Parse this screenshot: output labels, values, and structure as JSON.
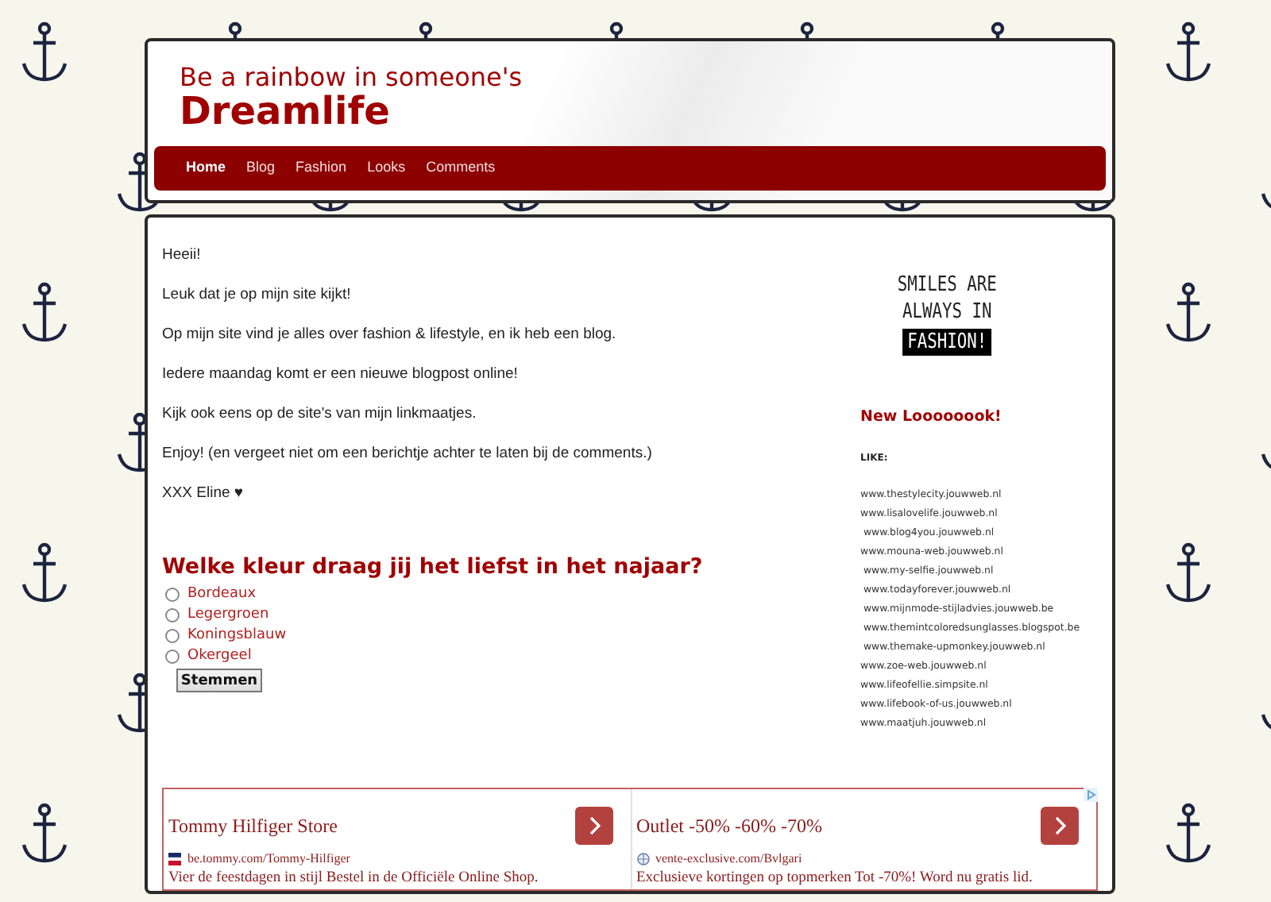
{
  "header": {
    "tagline": "Be a rainbow in someone's",
    "title": "Dreamlife"
  },
  "nav": [
    {
      "label": "Home",
      "selected": true
    },
    {
      "label": "Blog",
      "selected": false
    },
    {
      "label": "Fashion",
      "selected": false
    },
    {
      "label": "Looks",
      "selected": false
    },
    {
      "label": "Comments",
      "selected": false
    }
  ],
  "intro": [
    "Heeii!",
    "Leuk dat je op mijn site kijkt!",
    "Op mijn site vind je alles over fashion & lifestyle, en ik heb een blog.",
    "Iedere maandag komt er een nieuwe blogpost online!",
    "Kijk ook eens op de site's van mijn linkmaatjes.",
    "Enjoy! (en vergeet niet om een berichtje achter te laten bij de comments.)",
    "XXX Eline ♥"
  ],
  "poll": {
    "question": "Welke kleur draag jij het liefst in het najaar?",
    "options": [
      {
        "label": "Bordeaux",
        "selected": false
      },
      {
        "label": "Legergroen",
        "selected": false
      },
      {
        "label": "Koningsblauw",
        "selected": false
      },
      {
        "label": "Okergeel",
        "selected": false
      }
    ],
    "button": "Stemmen"
  },
  "sidebar": {
    "quote_lines": [
      "SMILES ARE",
      "ALWAYS IN"
    ],
    "quote_highlight": "FASHION!",
    "heading": "New Loooooook!",
    "like_label": "LIKE:",
    "links": [
      "www.thestylecity.jouwweb.nl",
      "www.lisalovelife.jouwweb.nl",
      " www.blog4you.jouwweb.nl",
      "www.mouna-web.jouwweb.nl",
      " www.my-selfie.jouwweb.nl",
      " www.todayforever.jouwweb.nl",
      " www.mijnmode-stijladvies.jouwweb.be",
      " www.themintcoloredsunglasses.blogspot.be",
      " www.themake-upmonkey.jouwweb.nl",
      "www.zoe-web.jouwweb.nl",
      "www.lifeofellie.simpsite.nl",
      "www.lifebook-of-us.jouwweb.nl",
      "www.maatjuh.jouwweb.nl"
    ]
  },
  "ads": [
    {
      "title": "Tommy Hilfiger Store",
      "url": "be.tommy.com/Tommy-Hilfiger",
      "text": "Vier de feestdagen in stijl Bestel in de Officiële Online Shop.",
      "kind": "flag"
    },
    {
      "title": "Outlet -50% -60% -70%",
      "url": "vente-exclusive.com/Bvlgari",
      "text": "Exclusieve kortingen op topmerken Tot -70%! Word nu gratis lid.",
      "kind": "globe"
    }
  ]
}
